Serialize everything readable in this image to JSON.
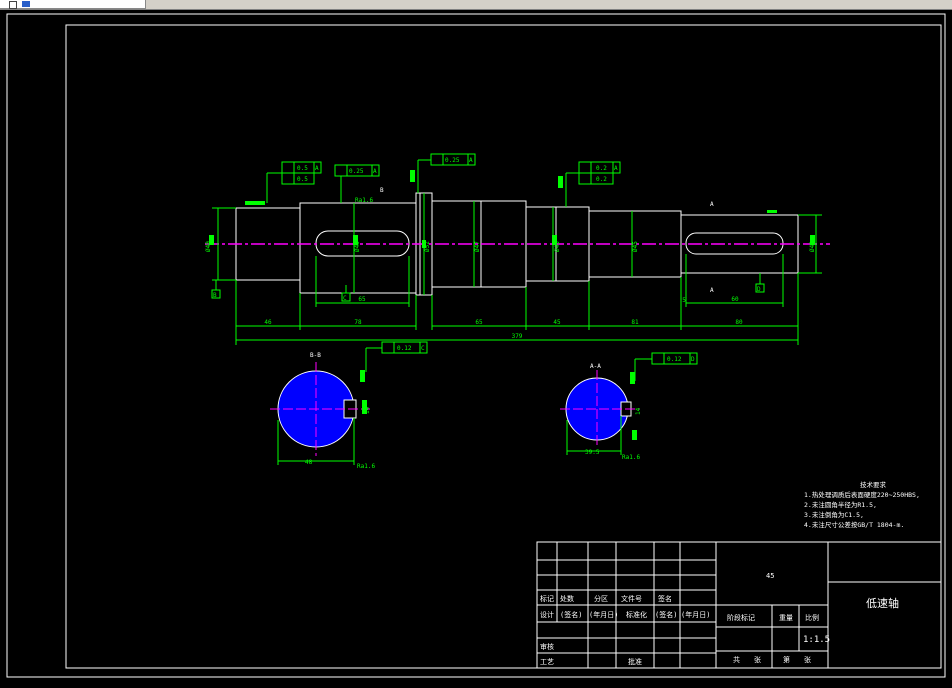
{
  "dims": {
    "d1": "Ø40",
    "d2": "Ø45",
    "d3": "Ø52",
    "d4": "Ø47",
    "d5": "Ø45",
    "d6": "Ø45",
    "d7": "Ø40",
    "bottom_segments": [
      "46",
      "78",
      "65",
      "45",
      "81",
      "80"
    ],
    "total": "379",
    "key1": "65",
    "key2": "60",
    "small1": "5",
    "small2": "5"
  },
  "tolerances": {
    "t1": "0.5",
    "t1_ref": "A",
    "t2": "0.5",
    "t3": "0.25",
    "t3_ref": "A",
    "t4": "0.25",
    "t4_ref": "A",
    "t5": "0.2",
    "t5_ref": "A",
    "t6": "0.2",
    "t7": "0.12",
    "t7_ref": "C",
    "t8": "0.12",
    "t8_ref": "D"
  },
  "datums": {
    "b": "B",
    "c": "C",
    "d": "D",
    "a_left": "A",
    "a_right": "A"
  },
  "roughness": {
    "r1": "Ra1.6",
    "r2": "Ra1.6",
    "r3": "Ra1.6",
    "r4": "Ra1.6"
  },
  "sections": {
    "left_label": "B-B",
    "right_label": "A-A",
    "left_width": "48",
    "right_width": "39.5",
    "left_key": "14",
    "right_key": "14"
  },
  "tech_req": {
    "title": "技术要求",
    "lines": [
      "1.热处理调质后表面硬度220~250HBS,",
      "2.未注圆角半径为R1.5,",
      "3.未注倒角为C1.5,",
      "4.未注尺寸公差按GB/T 1804-m."
    ]
  },
  "title_block": {
    "material": "45",
    "part_name": "低速轴",
    "row_a": [
      "标记",
      "处数",
      "分区",
      "文件号",
      "签名"
    ],
    "row_b": [
      "设计",
      "(签名)",
      "(年月日)",
      "标准化",
      "(签名)",
      "(年月日)"
    ],
    "stage": "阶段标记",
    "weight": "重量",
    "scale_label": "比例",
    "scale": "1:1.5",
    "review": "审核",
    "process": "工艺",
    "approve": "批准",
    "sheets": [
      "共",
      "张",
      "第",
      "张"
    ]
  },
  "colors": {
    "line": "#ffffff",
    "dim": "#00ff00",
    "center": "#ff00ff",
    "hatch": "#0000ff",
    "text": "#ffff00"
  }
}
